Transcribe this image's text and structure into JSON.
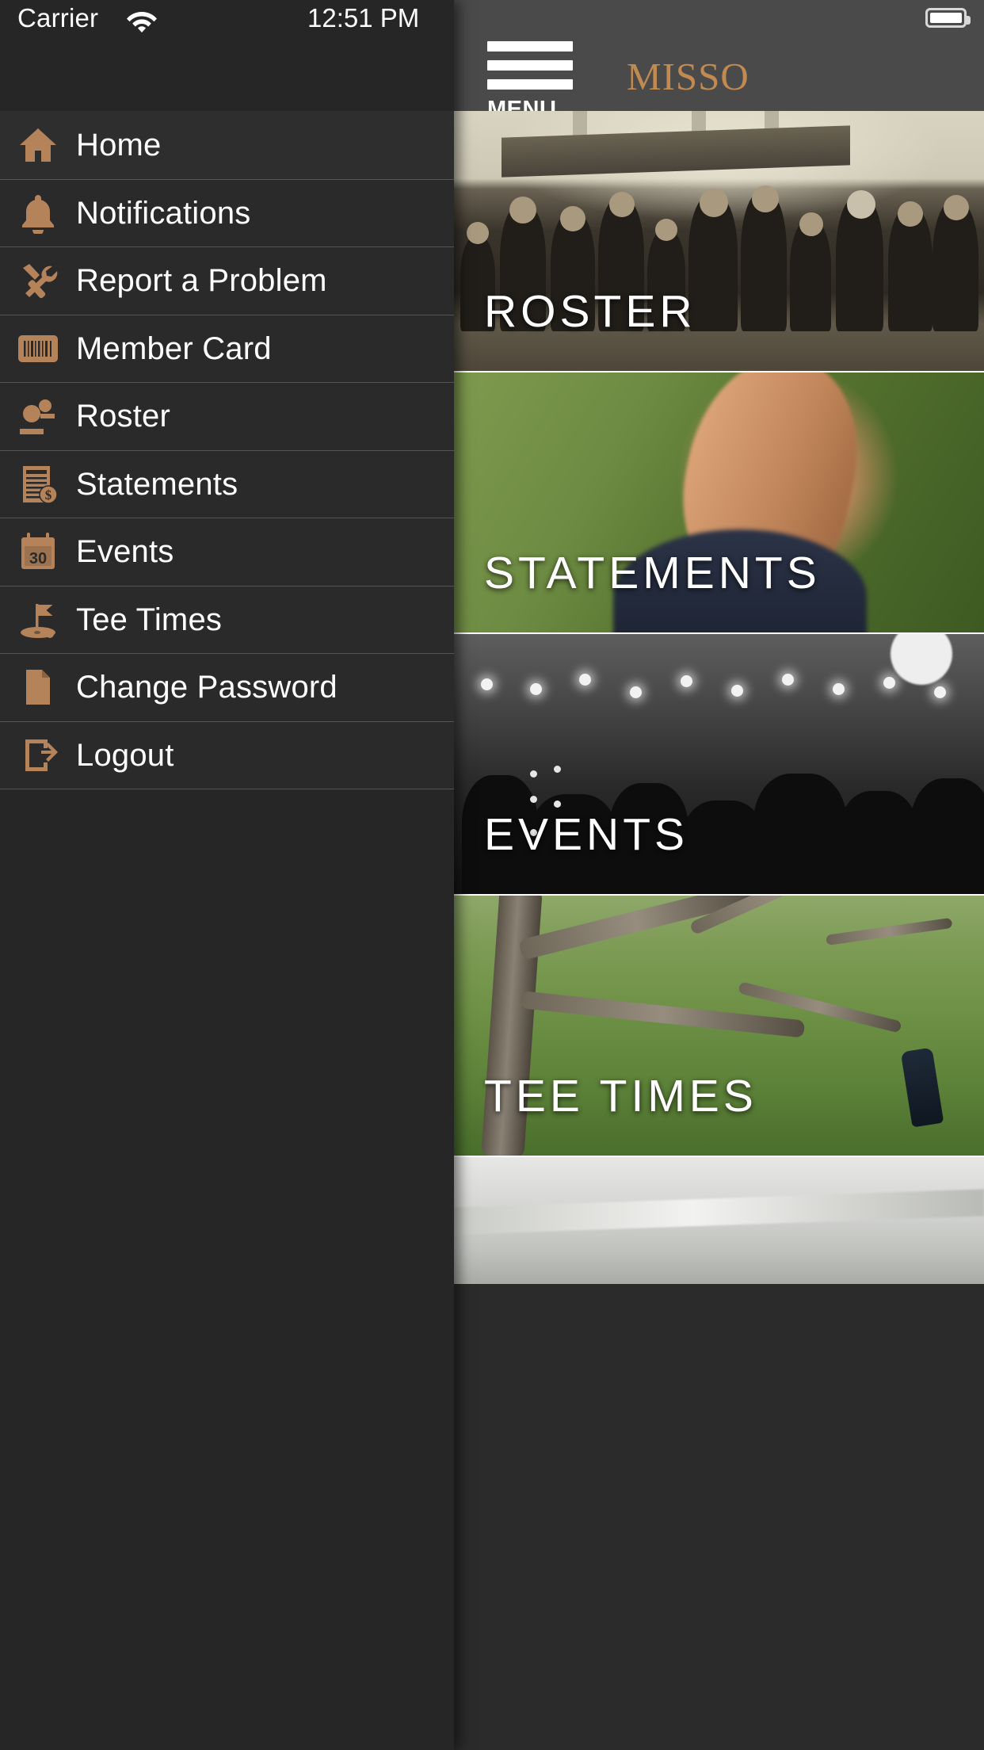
{
  "status_bar": {
    "carrier": "Carrier",
    "wifi_icon": "wifi-icon",
    "time": "12:51 PM",
    "battery_icon": "battery-icon"
  },
  "navbar": {
    "menu_icon": "hamburger-icon",
    "menu_label": "MENU",
    "club_title": "MISSO"
  },
  "drawer": {
    "items": [
      {
        "label": "Home",
        "icon": "home-icon"
      },
      {
        "label": "Notifications",
        "icon": "bell-icon"
      },
      {
        "label": "Report a Problem",
        "icon": "tools-icon"
      },
      {
        "label": "Member Card",
        "icon": "barcode-icon"
      },
      {
        "label": "Roster",
        "icon": "people-icon"
      },
      {
        "label": "Statements",
        "icon": "invoice-dollar-icon"
      },
      {
        "label": "Events",
        "icon": "calendar-icon"
      },
      {
        "label": "Tee Times",
        "icon": "golf-flag-icon"
      },
      {
        "label": "Change Password",
        "icon": "document-icon"
      },
      {
        "label": "Logout",
        "icon": "logout-icon"
      }
    ],
    "calendar_day": "30"
  },
  "content": {
    "cards": [
      {
        "label": "ROSTER"
      },
      {
        "label": "STATEMENTS"
      },
      {
        "label": "EVENTS"
      },
      {
        "label": "TEE TIMES"
      }
    ]
  },
  "colors": {
    "accent": "#b5835a",
    "title": "#c08a51",
    "drawer_bg": "#262626",
    "row_bg": "#2a2a2a",
    "navbar_bg": "#4a4a4a",
    "text": "#ffffff",
    "divider": "#545454"
  }
}
